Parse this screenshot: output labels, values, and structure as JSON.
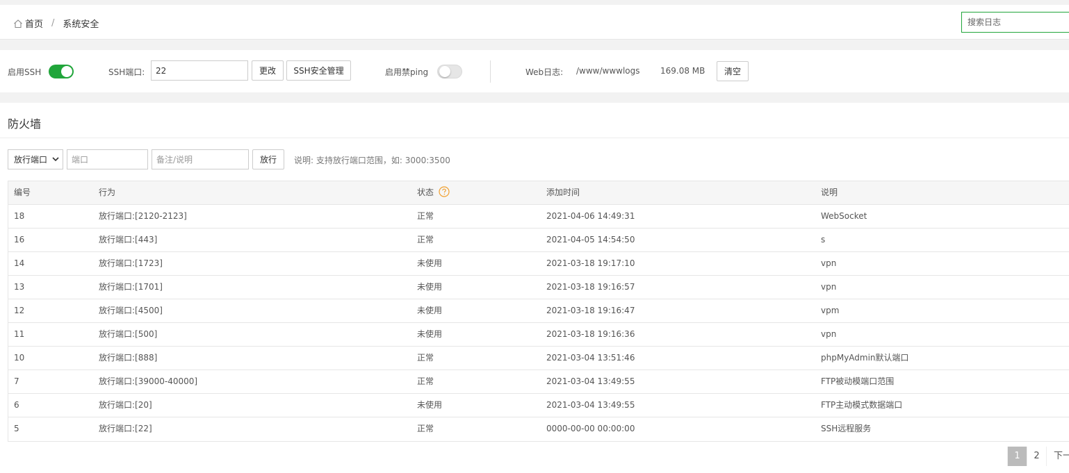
{
  "breadcrumb": {
    "home": "首页",
    "separator": "/",
    "current": "系统安全"
  },
  "search": {
    "placeholder": "搜索日志"
  },
  "controls": {
    "ssh_enable_label": "启用SSH",
    "ssh_enabled": true,
    "ssh_port_label": "SSH端口:",
    "ssh_port_value": "22",
    "change_button": "更改",
    "ssh_manage_button": "SSH安全管理",
    "ping_label": "启用禁ping",
    "ping_enabled": false,
    "weblog_label": "Web日志:",
    "weblog_path": "/www/wwwlogs",
    "weblog_size": "169.08 MB",
    "clear_button": "清空"
  },
  "firewall": {
    "title": "防火墙",
    "action_select": "放行端口",
    "port_placeholder": "端口",
    "note_placeholder": "备注/说明",
    "allow_button": "放行",
    "hint": "说明: 支持放行端口范围，如: 3000:3500",
    "columns": [
      "编号",
      "行为",
      "状态",
      "添加时间",
      "说明"
    ],
    "rows": [
      {
        "id": "18",
        "action": "放行端口:[2120-2123]",
        "status": "正常",
        "time": "2021-04-06 14:49:31",
        "note": "WebSocket"
      },
      {
        "id": "16",
        "action": "放行端口:[443]",
        "status": "正常",
        "time": "2021-04-05 14:54:50",
        "note": "s"
      },
      {
        "id": "14",
        "action": "放行端口:[1723]",
        "status": "未使用",
        "time": "2021-03-18 19:17:10",
        "note": "vpn"
      },
      {
        "id": "13",
        "action": "放行端口:[1701]",
        "status": "未使用",
        "time": "2021-03-18 19:16:57",
        "note": "vpn"
      },
      {
        "id": "12",
        "action": "放行端口:[4500]",
        "status": "未使用",
        "time": "2021-03-18 19:16:47",
        "note": "vpm"
      },
      {
        "id": "11",
        "action": "放行端口:[500]",
        "status": "未使用",
        "time": "2021-03-18 19:16:36",
        "note": "vpn"
      },
      {
        "id": "10",
        "action": "放行端口:[888]",
        "status": "正常",
        "time": "2021-03-04 13:51:46",
        "note": "phpMyAdmin默认端口"
      },
      {
        "id": "7",
        "action": "放行端口:[39000-40000]",
        "status": "正常",
        "time": "2021-03-04 13:49:55",
        "note": "FTP被动模端口范围"
      },
      {
        "id": "6",
        "action": "放行端口:[20]",
        "status": "未使用",
        "time": "2021-03-04 13:49:55",
        "note": "FTP主动模式数据端口"
      },
      {
        "id": "5",
        "action": "放行端口:[22]",
        "status": "正常",
        "time": "0000-00-00 00:00:00",
        "note": "SSH远程服务"
      }
    ]
  },
  "pagination": {
    "pages": [
      "1",
      "2"
    ],
    "current": "1",
    "next": "下一"
  },
  "colors": {
    "accent": "#20a53a",
    "help": "#f0a030"
  }
}
